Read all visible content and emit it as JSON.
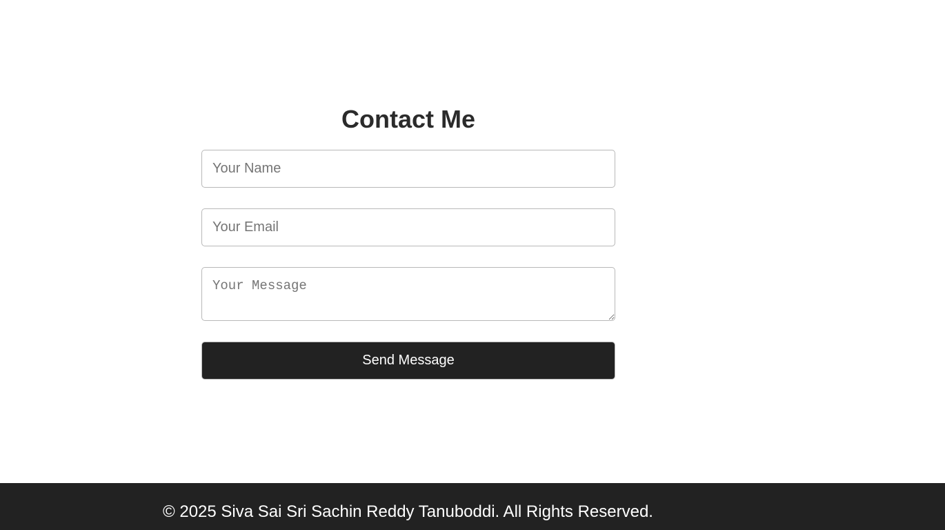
{
  "contact": {
    "title": "Contact Me",
    "name_placeholder": "Your Name",
    "email_placeholder": "Your Email",
    "message_placeholder": "Your Message",
    "submit_label": "Send Message"
  },
  "footer": {
    "copyright": "© 2025 Siva Sai Sri Sachin Reddy Tanuboddi. All Rights Reserved."
  },
  "colors": {
    "background": "#ffffff",
    "title_text": "#2b2b2b",
    "button_background": "#222222",
    "footer_background": "#222222",
    "footer_text": "#ffffff"
  }
}
